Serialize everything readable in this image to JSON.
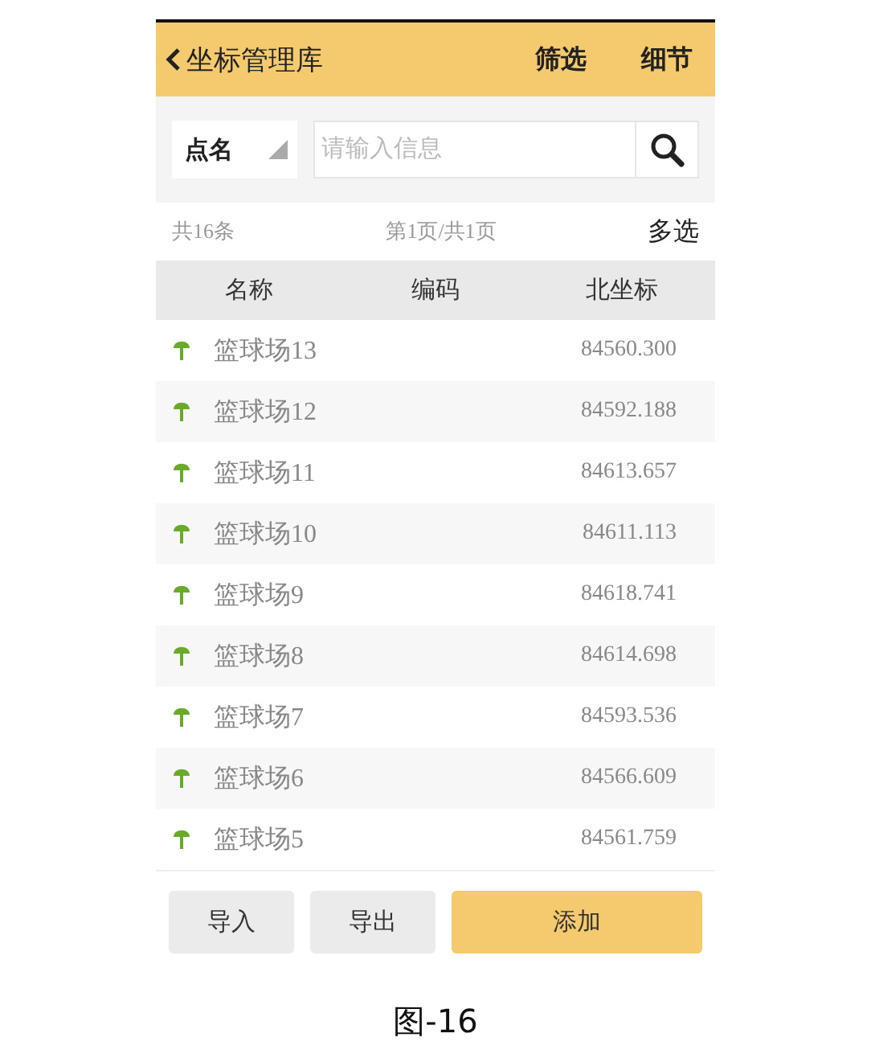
{
  "header": {
    "title": "坐标管理库",
    "actions": [
      "筛选",
      "细节"
    ]
  },
  "search": {
    "field_select": "点名",
    "placeholder": "请输入信息"
  },
  "summary": {
    "total": "共16条",
    "page": "第1页/共1页",
    "multi_select": "多选"
  },
  "table": {
    "columns": [
      "名称",
      "编码",
      "北坐标"
    ],
    "rows": [
      {
        "name": "篮球场13",
        "north": "84560.300"
      },
      {
        "name": "篮球场12",
        "north": "84592.188"
      },
      {
        "name": "篮球场11",
        "north": "84613.657"
      },
      {
        "name": "篮球场10",
        "north": "84611.113"
      },
      {
        "name": "篮球场9",
        "north": "84618.741"
      },
      {
        "name": "篮球场8",
        "north": "84614.698"
      },
      {
        "name": "篮球场7",
        "north": "84593.536"
      },
      {
        "name": "篮球场6",
        "north": "84566.609"
      },
      {
        "name": "篮球场5",
        "north": "84561.759"
      }
    ]
  },
  "footer": {
    "buttons": [
      {
        "label": "导入",
        "kind": "secondary"
      },
      {
        "label": "导出",
        "kind": "secondary"
      },
      {
        "label": "添加",
        "kind": "primary"
      }
    ]
  },
  "caption": "图-16"
}
